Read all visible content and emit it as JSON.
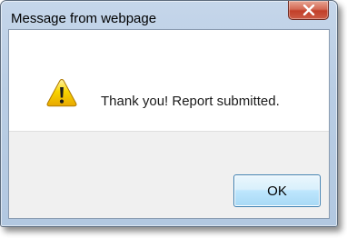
{
  "window": {
    "title": "Message from webpage",
    "close_icon": "close-x-icon"
  },
  "dialog": {
    "icon": "warning-icon",
    "message": "Thank you! Report submitted.",
    "ok_label": "OK"
  },
  "colors": {
    "frame": "#b9cde4",
    "close_button": "#c7452f",
    "warning_yellow": "#f5c400",
    "ok_button_border": "#3c7fb1"
  }
}
